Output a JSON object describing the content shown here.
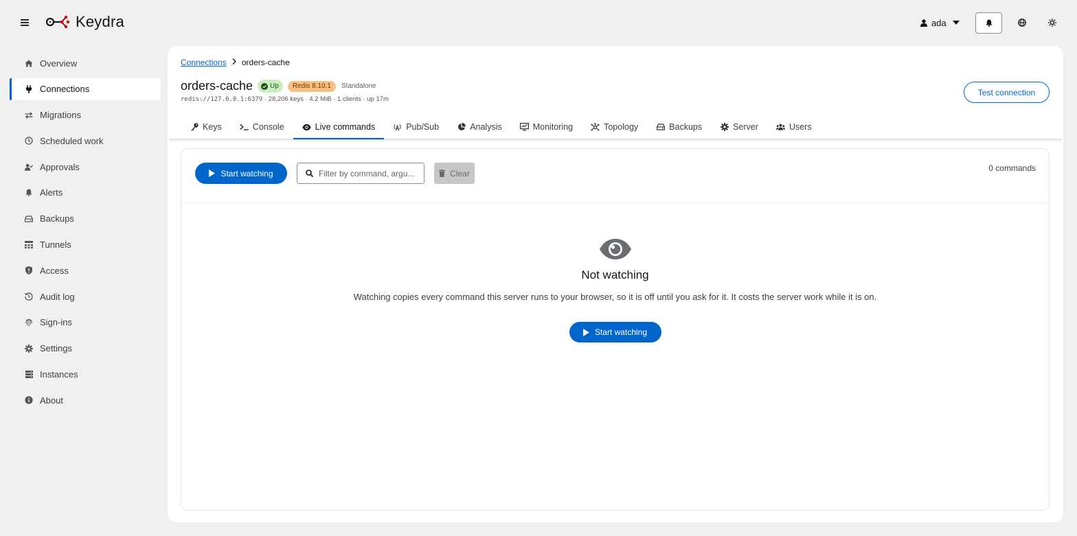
{
  "app": {
    "name": "Keydra"
  },
  "header": {
    "user": "ada"
  },
  "sidebar": {
    "items": [
      {
        "label": "Overview",
        "icon": "home-icon"
      },
      {
        "label": "Connections",
        "icon": "plug-icon",
        "active": true
      },
      {
        "label": "Migrations",
        "icon": "arrows-exchange-icon"
      },
      {
        "label": "Scheduled work",
        "icon": "clock-icon"
      },
      {
        "label": "Approvals",
        "icon": "user-check-icon"
      },
      {
        "label": "Alerts",
        "icon": "bell-icon"
      },
      {
        "label": "Backups",
        "icon": "drive-icon"
      },
      {
        "label": "Tunnels",
        "icon": "network-icon"
      },
      {
        "label": "Access",
        "icon": "shield-icon"
      },
      {
        "label": "Audit log",
        "icon": "history-icon"
      },
      {
        "label": "Sign-ins",
        "icon": "fingerprint-icon"
      },
      {
        "label": "Settings",
        "icon": "gear-icon"
      },
      {
        "label": "Instances",
        "icon": "server-icon"
      },
      {
        "label": "About",
        "icon": "info-icon"
      }
    ]
  },
  "breadcrumb": {
    "parent": "Connections",
    "current": "orders-cache"
  },
  "connection": {
    "name": "orders-cache",
    "status": "Up",
    "version": "Redis 8.10.1",
    "mode": "Standalone",
    "url": "redis://127.0.0.1:6379",
    "stats": "· 28,206 keys · 4.2 MiB · 1 clients · up 17m",
    "test_label": "Test connection"
  },
  "tabs": [
    {
      "label": "Keys",
      "icon": "key-icon"
    },
    {
      "label": "Console",
      "icon": "terminal-icon"
    },
    {
      "label": "Live commands",
      "icon": "eye-icon",
      "active": true
    },
    {
      "label": "Pub/Sub",
      "icon": "broadcast-icon"
    },
    {
      "label": "Analysis",
      "icon": "pie-chart-icon"
    },
    {
      "label": "Monitoring",
      "icon": "chart-monitor-icon"
    },
    {
      "label": "Topology",
      "icon": "topology-icon"
    },
    {
      "label": "Backups",
      "icon": "drive-icon"
    },
    {
      "label": "Server",
      "icon": "gear-icon"
    },
    {
      "label": "Users",
      "icon": "users-icon"
    }
  ],
  "live": {
    "start_label": "Start watching",
    "filter_placeholder": "Filter by command, argu...",
    "clear_label": "Clear",
    "count_label": "0 commands",
    "empty_title": "Not watching",
    "empty_text": "Watching copies every command this server runs to your browser, so it is off until you ask for it. It costs the server work while it is on.",
    "empty_button": "Start watching"
  },
  "colors": {
    "accent": "#0066cc",
    "status_up": "#cdeec1",
    "version_badge": "#f7c185"
  }
}
